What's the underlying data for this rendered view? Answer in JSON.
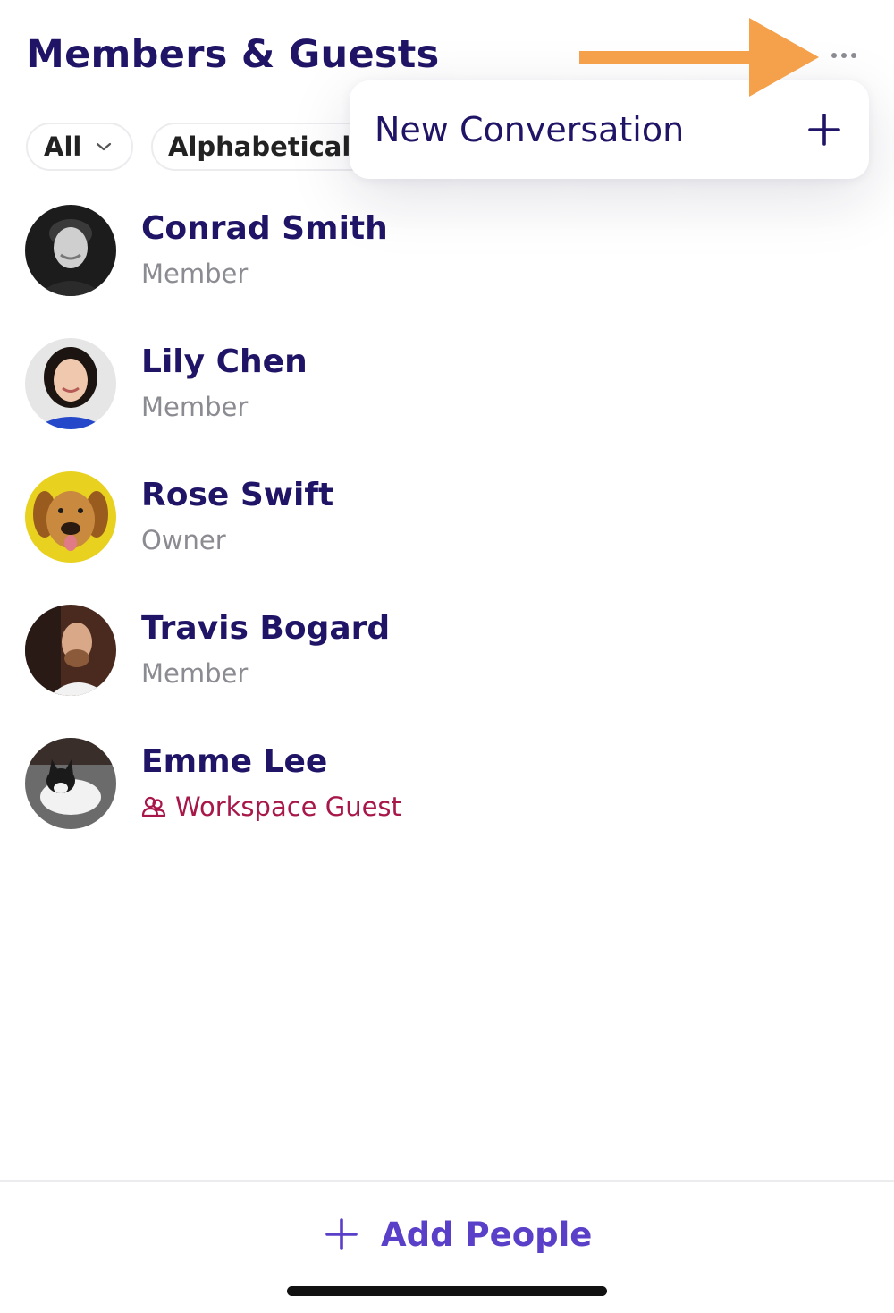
{
  "header": {
    "title": "Members & Guests",
    "more_icon": "ellipsis-icon"
  },
  "filters": {
    "type": {
      "selected": "All",
      "icon": "chevron-down-icon"
    },
    "sort": {
      "selected": "Alphabetical"
    }
  },
  "menu": {
    "items": [
      {
        "label": "New Conversation",
        "icon": "plus-icon"
      }
    ]
  },
  "annotation": {
    "icon": "arrow-right-icon",
    "color": "#f5a04a"
  },
  "members": [
    {
      "name": "Conrad Smith",
      "role": "Member",
      "avatar": "person-photo"
    },
    {
      "name": "Lily Chen",
      "role": "Member",
      "avatar": "person-photo"
    },
    {
      "name": "Rose Swift",
      "role": "Owner",
      "avatar": "dog-photo"
    },
    {
      "name": "Travis Bogard",
      "role": "Member",
      "avatar": "person-photo"
    },
    {
      "name": "Emme Lee",
      "role": "Workspace Guest",
      "role_icon": "guest-icon",
      "avatar": "cat-photo"
    }
  ],
  "footer": {
    "add_label": "Add People",
    "icon": "plus-icon"
  },
  "colors": {
    "primary_text": "#1f1466",
    "secondary_text": "#8b8b92",
    "guest": "#a8174a",
    "accent": "#5a3fc8"
  }
}
